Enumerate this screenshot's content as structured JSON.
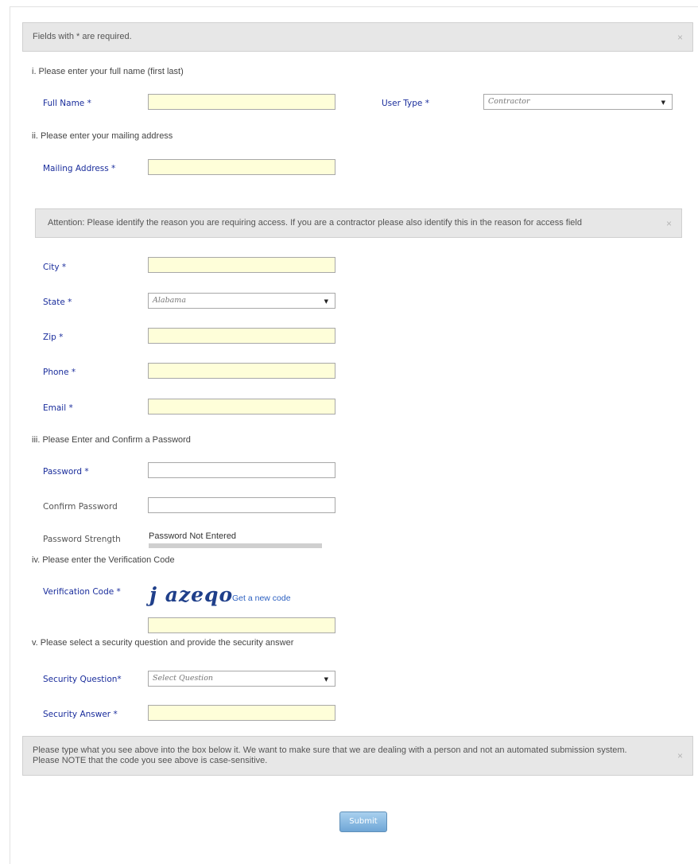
{
  "alerts": {
    "required": "Fields with * are required.",
    "attention": "Attention: Please identify the reason you are requiring access. If you are a contractor please also identify this in the reason for access field",
    "captcha_note_line1": "Please type what you see above into the box below it. We want to make sure that we are dealing with a person and not an automated submission system.",
    "captcha_note_line2": "Please NOTE that the code you see above is case-sensitive.",
    "close_glyph": "×"
  },
  "sections": {
    "name": "i. Please enter your full name (first last)",
    "address": "ii. Please enter your mailing address",
    "password": "iii. Please Enter and Confirm a Password",
    "verification": "iv. Please enter the Verification Code",
    "security": "v. Please select a security question and provide the security answer"
  },
  "fields": {
    "full_name": {
      "label": "Full Name *",
      "value": ""
    },
    "user_type": {
      "label": "User Type *",
      "selected": "Contractor"
    },
    "mailing_address": {
      "label": "Mailing Address *",
      "value": ""
    },
    "city": {
      "label": "City *",
      "value": ""
    },
    "state": {
      "label": "State *",
      "selected": "Alabama"
    },
    "zip": {
      "label": "Zip *",
      "value": ""
    },
    "phone": {
      "label": "Phone *",
      "value": ""
    },
    "email": {
      "label": "Email *",
      "value": ""
    },
    "password": {
      "label": "Password *",
      "value": ""
    },
    "confirm_password": {
      "label": "Confirm Password",
      "value": ""
    },
    "password_strength": {
      "label": "Password Strength",
      "value": "Password Not Entered",
      "level": 0
    },
    "verification_code": {
      "label": "Verification Code *",
      "captcha_text": "j azeqo",
      "new_code_link": "Get a new code",
      "value": ""
    },
    "security_question": {
      "label": "Security Question*",
      "selected": "Select Question"
    },
    "security_answer": {
      "label": "Security Answer *",
      "value": ""
    }
  },
  "submit_label": "Submit",
  "dropdown_icon": "caret-down-icon",
  "colors": {
    "label_blue": "#1a2d9c",
    "input_yellow": "#fefed9",
    "alert_gray": "#e7e7e7",
    "link_blue": "#2b5fc0"
  }
}
